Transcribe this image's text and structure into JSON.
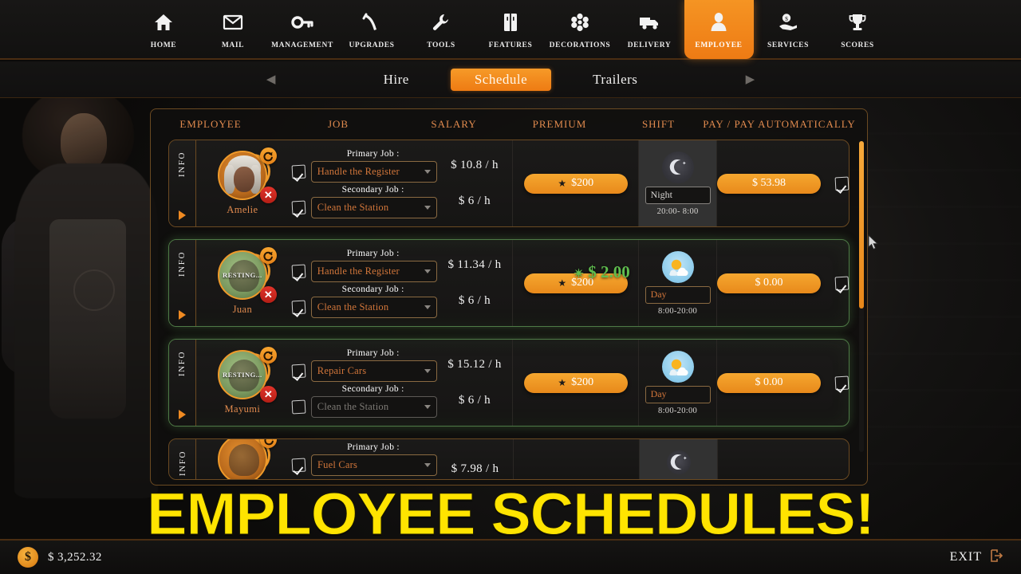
{
  "topnav": {
    "items": [
      {
        "label": "HOME",
        "icon": "home-icon",
        "active": false
      },
      {
        "label": "MAIL",
        "icon": "mail-icon",
        "active": false
      },
      {
        "label": "MANAGEMENT",
        "icon": "key-icon",
        "active": false
      },
      {
        "label": "UPGRADES",
        "icon": "pickaxe-icon",
        "active": false
      },
      {
        "label": "TOOLS",
        "icon": "wrench-icon",
        "active": false
      },
      {
        "label": "FEATURES",
        "icon": "fridge-icon",
        "active": false
      },
      {
        "label": "DECORATIONS",
        "icon": "flower-icon",
        "active": false
      },
      {
        "label": "DELIVERY",
        "icon": "truck-icon",
        "active": false
      },
      {
        "label": "EMPLOYEE",
        "icon": "person-icon",
        "active": true
      },
      {
        "label": "SERVICES",
        "icon": "hand-coin-icon",
        "active": false
      },
      {
        "label": "SCORES",
        "icon": "trophy-icon",
        "active": false
      }
    ]
  },
  "subtabs": {
    "prev_arrow": "◀",
    "next_arrow": "▶",
    "items": [
      {
        "label": "Hire",
        "active": false
      },
      {
        "label": "Schedule",
        "active": true
      },
      {
        "label": "Trailers",
        "active": false
      }
    ]
  },
  "table": {
    "columns": [
      "EMPLOYEE",
      "JOB",
      "SALARY",
      "PREMIUM",
      "SHIFT",
      "PAY / PAY AUTOMATICALLY"
    ],
    "primary_job_label": "Primary Job :",
    "secondary_job_label": "Secondary Job :",
    "info_tab_label": "INFO",
    "rows": [
      {
        "name": "Amelie",
        "status": "",
        "resting": false,
        "primary_job": "Handle the Register",
        "primary_checked": true,
        "secondary_job": "Clean the Station",
        "secondary_checked": true,
        "primary_salary": "$ 10.8 / h",
        "secondary_salary": "$ 6 / h",
        "premium": "$200",
        "premium_gain": "",
        "shift": "Night",
        "shift_hours": "20:00- 8:00",
        "shift_icon": "moon-icon",
        "pay": "$ 53.98",
        "auto_pay_checked": true
      },
      {
        "name": "Juan",
        "status": "RESTING...",
        "resting": true,
        "primary_job": "Handle the Register",
        "primary_checked": true,
        "secondary_job": "Clean the Station",
        "secondary_checked": true,
        "primary_salary": "$ 11.34 / h",
        "secondary_salary": "$ 6 / h",
        "premium": "$200",
        "premium_gain": "$ 2.00",
        "shift": "Day",
        "shift_hours": "8:00-20:00",
        "shift_icon": "sun-cloud-icon",
        "pay": "$ 0.00",
        "auto_pay_checked": true
      },
      {
        "name": "Mayumi",
        "status": "RESTING...",
        "resting": true,
        "primary_job": "Repair Cars",
        "primary_checked": true,
        "secondary_job": "Clean the Station",
        "secondary_checked": false,
        "primary_salary": "$ 15.12 / h",
        "secondary_salary": "$ 6 / h",
        "premium": "$200",
        "premium_gain": "",
        "shift": "Day",
        "shift_hours": "8:00-20:00",
        "shift_icon": "sun-cloud-icon",
        "pay": "$ 0.00",
        "auto_pay_checked": true
      }
    ],
    "partial_row": {
      "primary_job_label": "Primary Job :",
      "primary_job": "Fuel Cars",
      "primary_checked": true,
      "primary_salary": "$ 7.98 / h",
      "shift_icon": "moon-icon"
    }
  },
  "bottom": {
    "money": "$ 3,252.32",
    "currency_symbol": "$",
    "exit_label": "EXIT"
  },
  "overlay": {
    "headline": "EMPLOYEE SCHEDULES!"
  },
  "colors": {
    "accent": "#ee7b14",
    "accent_light": "#f5a72f",
    "header_text": "#e08a4e",
    "job_text": "#d2763a",
    "resting_border": "#4e7a46",
    "gain_green": "#5fbd4e",
    "headline_yellow": "#ffe400",
    "danger_red": "#e2342a"
  }
}
